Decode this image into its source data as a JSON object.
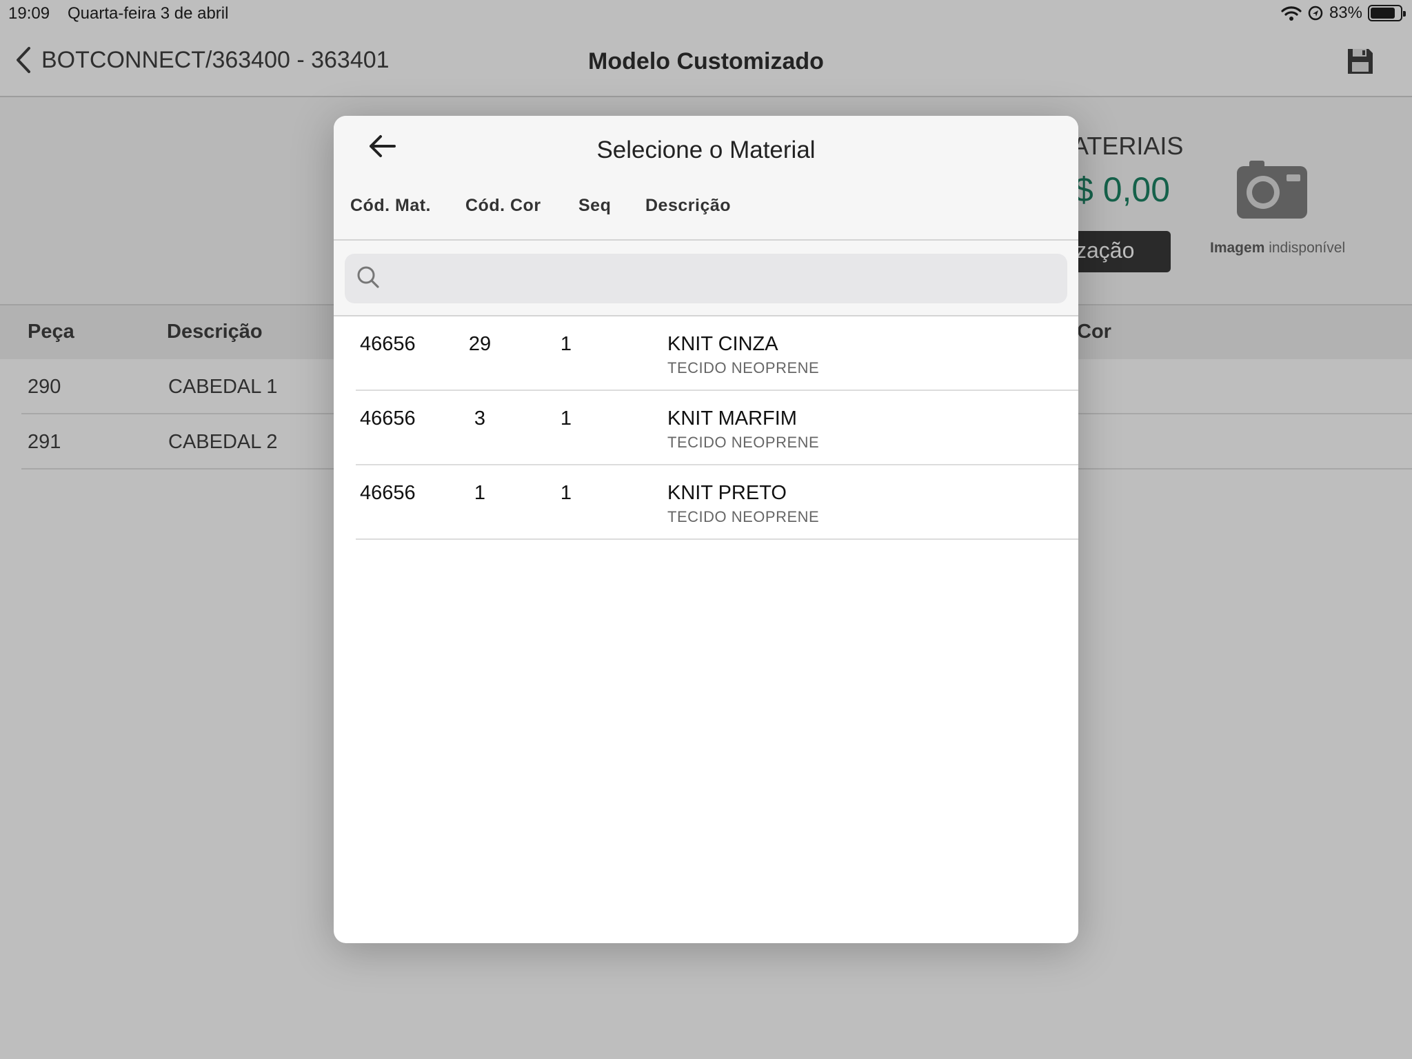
{
  "status_bar": {
    "time": "19:09",
    "date": "Quarta-feira 3 de abril",
    "battery": "83%",
    "battery_level": 0.83
  },
  "nav": {
    "back_label": "BOTCONNECT/363400 - 363401",
    "title": "Modelo Customizado"
  },
  "summary": {
    "label": "ATERIAIS",
    "value": "$ 0,00",
    "button_label": "zação",
    "image_bold": "Imagem",
    "image_rest": " indisponível"
  },
  "pieces_table": {
    "headers": [
      "Peça",
      "Descrição",
      "Cor"
    ],
    "rows": [
      {
        "piece": "290",
        "description": "CABEDAL 1"
      },
      {
        "piece": "291",
        "description": "CABEDAL 2"
      }
    ]
  },
  "modal": {
    "title": "Selecione o Material",
    "columns": [
      "Cód. Mat.",
      "Cód. Cor",
      "Seq",
      "Descrição"
    ],
    "search": {
      "placeholder": "",
      "value": ""
    },
    "rows": [
      {
        "cod_mat": "46656",
        "cod_cor": "29",
        "seq": "1",
        "descricao": "KNIT CINZA",
        "subtitulo": "TECIDO NEOPRENE"
      },
      {
        "cod_mat": "46656",
        "cod_cor": "3",
        "seq": "1",
        "descricao": "KNIT MARFIM",
        "subtitulo": "TECIDO NEOPRENE"
      },
      {
        "cod_mat": "46656",
        "cod_cor": "1",
        "seq": "1",
        "descricao": "KNIT PRETO",
        "subtitulo": "TECIDO NEOPRENE"
      }
    ]
  },
  "colors": {
    "accent_green": "#0e7a5a",
    "dark_button": "#2b2b2b"
  },
  "icons": [
    "chevron-left-icon",
    "save-icon",
    "camera-icon",
    "wifi-icon",
    "location-icon",
    "battery-icon",
    "arrow-left-icon",
    "search-icon"
  ]
}
